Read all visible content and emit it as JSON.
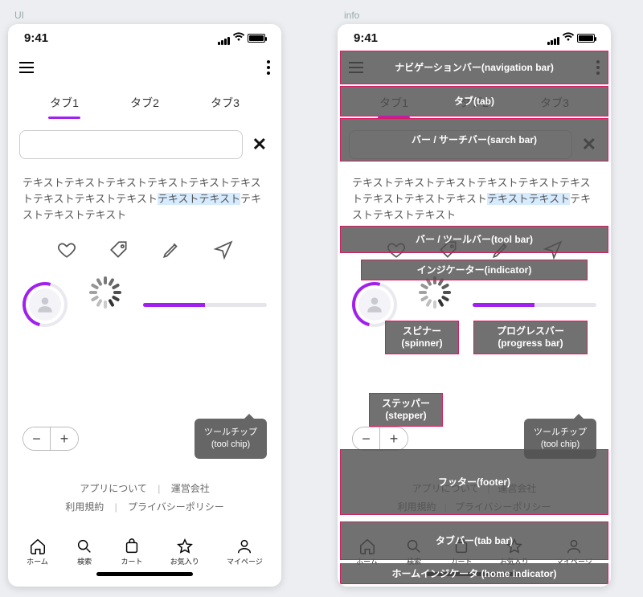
{
  "columns": {
    "left": "UI",
    "right": "info"
  },
  "status": {
    "time": "9:41"
  },
  "accent": "#a020f0",
  "tabs": [
    {
      "label": "タブ1",
      "active": true
    },
    {
      "label": "タブ2",
      "active": false
    },
    {
      "label": "タブ3",
      "active": false
    }
  ],
  "search": {
    "value": "",
    "placeholder": ""
  },
  "body_text": {
    "pre": "テキストテキストテキストテキストテキストテキストテキストテキストテキスト",
    "highlight": "テキストテキスト",
    "post": "テキストテキストテキスト"
  },
  "toolbar_icons": [
    "heart-icon",
    "tag-icon",
    "pencil-icon",
    "send-icon"
  ],
  "progress_pct": 50,
  "stepper": {
    "minus": "−",
    "plus": "+"
  },
  "tooltip": {
    "line1": "ツールチップ",
    "line2": "(tool chip)"
  },
  "footer": {
    "about": "アプリについて",
    "company": "運営会社",
    "terms": "利用規約",
    "privacy": "プライバシーポリシー",
    "sep": "|"
  },
  "tabbar": [
    {
      "icon": "home-icon",
      "label": "ホーム"
    },
    {
      "icon": "search-icon",
      "label": "検索"
    },
    {
      "icon": "cart-icon",
      "label": "カート"
    },
    {
      "icon": "star-icon",
      "label": "お気入り"
    },
    {
      "icon": "user-icon",
      "label": "マイページ"
    }
  ],
  "annots": {
    "nav": "ナビゲーションバー(navigation bar)",
    "tab": "タブ(tab)",
    "search": "バー / サーチバー(sarch bar)",
    "tool": "バー / ツールバー(tool bar)",
    "ind": "インジケーター(indicator)",
    "spin": "スピナー\n(spinner)",
    "prog": "プログレスバー\n(progress bar)",
    "step": "ステッパー\n(stepper)",
    "foot": "フッター(footer)",
    "tabbar": "タブバー(tab bar)",
    "home": "ホームインジケータ (home indicator)"
  }
}
